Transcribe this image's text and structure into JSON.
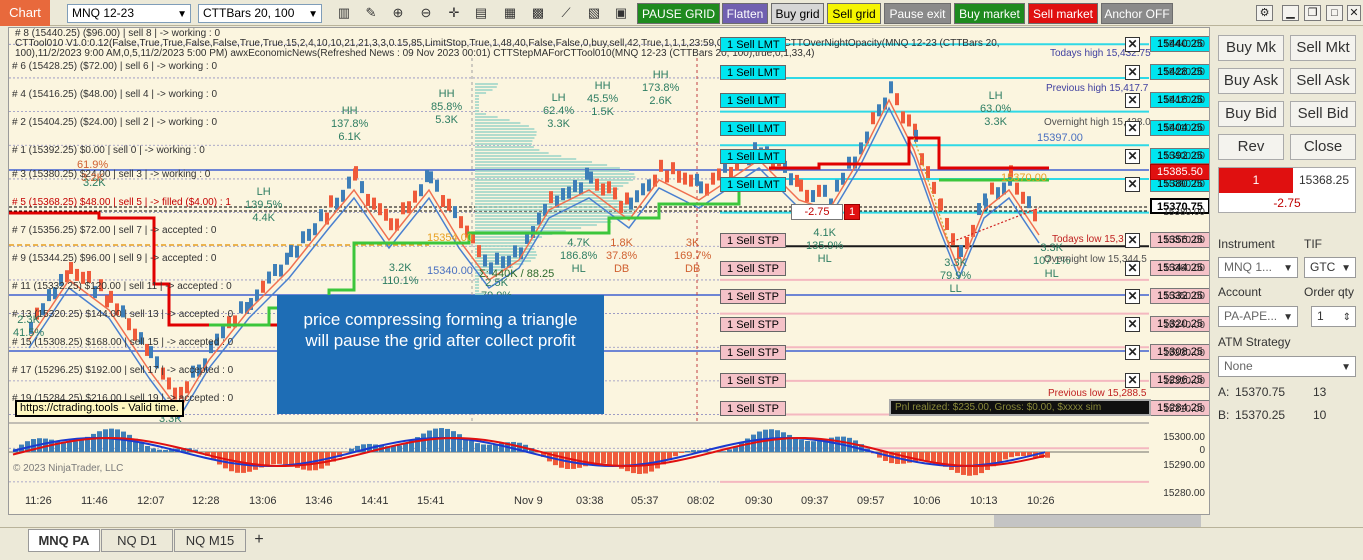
{
  "toolbar": {
    "chart_tab": "Chart",
    "instrument": "MNQ 12-23",
    "bars": "CTTBars 20, 100",
    "buttons": [
      {
        "label": "PAUSE GRID",
        "bg": "#1e8a1e",
        "fg": "#ffffff"
      },
      {
        "label": "Flatten",
        "bg": "#7060b0",
        "fg": "#ffffff"
      },
      {
        "label": "Buy grid",
        "bg": "#d6d6d6",
        "fg": "#000000"
      },
      {
        "label": "Sell grid",
        "bg": "#f5f500",
        "fg": "#000000"
      },
      {
        "label": "Pause exit",
        "bg": "#8a8a8a",
        "fg": "#ffffff"
      },
      {
        "label": "Buy market",
        "bg": "#1e8a1e",
        "fg": "#ffffff"
      },
      {
        "label": "Sell market",
        "bg": "#e01010",
        "fg": "#ffffff"
      },
      {
        "label": "Anchor OFF",
        "bg": "#8a8a8a",
        "fg": "#ffffff"
      }
    ],
    "icons": [
      "bar-type-icon",
      "pencil-icon",
      "zoom-in-icon",
      "zoom-out-icon",
      "crosshair-icon",
      "properties-icon",
      "strategies-icon",
      "indicators-icon",
      "templates-icon",
      "snapshot-icon",
      "data-box-icon"
    ]
  },
  "chart": {
    "header_lines": [
      "# 8 (15440.25) ($96.00) | sell 8 | -> working : 0",
      "CTTool010 V1.0:0.12(False,True,True,False,False,True,True,15,2,4,10,10,21,21,3,3,0.15,85,LimitStop,True,1,48,40,False,False,0,buy,sell,42,True,1,1,1,23:59,00:00,4,False) CTTOverNightOpacity(MNQ 12-23 (CTTBars 20,",
      "100),11/2/2023 9:00 AM,0,5,11/2/2023 5:00 PM) awxEconomicNews(Refreshed News : 09 Nov 2023 00:01) CTTStepMAForCTTool010(MNQ 12-23 (CTTBars 20, 100),true,0,1,33,4)"
    ],
    "grid_labels": [
      {
        "text": "# 6 (15428.25) ($72.00) | sell 6 | -> working : 0",
        "filled": false
      },
      {
        "text": "# 4 (15416.25) ($48.00) | sell 4 | -> working : 0",
        "filled": false
      },
      {
        "text": "# 2 (15404.25) ($24.00) | sell 2 | -> working : 0",
        "filled": false
      },
      {
        "text": "# 1 (15392.25) $0.00 | sell 0 | -> working : 0",
        "filled": false
      },
      {
        "text": "# 3 (15380.25) $24.00 | sell 3 | -> working : 0",
        "filled": false
      },
      {
        "text": "# 5 (15368.25) $48.00 | sell 5 | -> filled ($4.00) : 1",
        "filled": true
      },
      {
        "text": "# 7 (15356.25) $72.00 | sell 7 | -> accepted : 0",
        "filled": false
      },
      {
        "text": "# 9 (15344.25) $96.00 | sell 9 | -> accepted : 0",
        "filled": false
      },
      {
        "text": "# 11 (15332.25) $120.00 | sell 11 | -> accepted : 0",
        "filled": false
      },
      {
        "text": "# 13 (15320.25) $144.00 | sell 13 | -> accepted : 0",
        "filled": false
      },
      {
        "text": "# 15 (15308.25) $168.00 | sell 15 | -> accepted : 0",
        "filled": false
      },
      {
        "text": "# 17 (15296.25) $192.00 | sell 17 | -> accepted : 0",
        "filled": false
      },
      {
        "text": "# 19 (15284.25) $216.00 | sell 19 | -> accepted : 0",
        "filled": false
      }
    ],
    "swing_labels": [
      {
        "l1": "HH",
        "l2": "137.8%",
        "l3": "6.1K",
        "red": false
      },
      {
        "l1": "HH",
        "l2": "85.8%",
        "l3": "5.3K",
        "red": false
      },
      {
        "l1": "LH",
        "l2": "62.4%",
        "l3": "3.3K",
        "red": false
      },
      {
        "l1": "HH",
        "l2": "45.5%",
        "l3": "1.5K",
        "red": false
      },
      {
        "l1": "HH",
        "l2": "173.8%",
        "l3": "2.6K",
        "red": false
      },
      {
        "l1": "LH",
        "l2": "139.5%",
        "l3": "4.4K",
        "red": false
      },
      {
        "l1": "3.2K",
        "l2": "110.1%",
        "l3": "",
        "red": false
      },
      {
        "l1": "4.7K",
        "l2": "186.8%",
        "l3": "HL",
        "red": false
      },
      {
        "l1": "1.8K",
        "l2": "37.8%",
        "l3": "DB",
        "red": true
      },
      {
        "l1": "3K",
        "l2": "169.7%",
        "l3": "DB",
        "red": true
      },
      {
        "l1": "4.1K",
        "l2": "135.9%",
        "l3": "HL",
        "red": false
      },
      {
        "l1": "LH",
        "l2": "63.0%",
        "l3": "3.3K",
        "red": false
      },
      {
        "l1": "3.3K",
        "l2": "79.9%",
        "l3": "LL",
        "red": false
      },
      {
        "l1": "3.3K",
        "l2": "107.1%",
        "l3": "HL",
        "red": false
      },
      {
        "l1": "61.9%",
        "l2": "3.2K",
        "l3": "",
        "red": true
      },
      {
        "l1": "2.3K",
        "l2": "41.5%",
        "l3": "",
        "red": false
      },
      {
        "l1": "2.5K",
        "l2": "79.9%",
        "l3": "",
        "red": false
      },
      {
        "l1": "3.3K",
        "l2": "",
        "l3": "",
        "red": false
      },
      {
        "l1": "3.2K",
        "l2": "",
        "l3": "",
        "red": false
      }
    ],
    "sigma_label": "Σ: 440K / 88.25",
    "level_tags": [
      "15354.00",
      "15340.00",
      "15397.00",
      "15370.00"
    ],
    "annotations": {
      "todays_high": "Todays high 15,432.75",
      "previous_high": "Previous high 15,417.7",
      "overnight_high": "Overnight high 15,428.0",
      "todays_low": "Todays low 15,3",
      "overnight_low": "Overnight low 15,344.5",
      "previous_low": "Previous low 15,288.5"
    },
    "orders": [
      {
        "qty": "1",
        "label": "Sell LMT",
        "price": "15440.25",
        "kind": "lmt"
      },
      {
        "qty": "1",
        "label": "Sell LMT",
        "price": "15428.25",
        "kind": "lmt"
      },
      {
        "qty": "1",
        "label": "Sell LMT",
        "price": "15416.25",
        "kind": "lmt"
      },
      {
        "qty": "1",
        "label": "Sell LMT",
        "price": "15404.25",
        "kind": "lmt"
      },
      {
        "qty": "1",
        "label": "Sell LMT",
        "price": "15392.25",
        "kind": "lmt"
      },
      {
        "qty": "1",
        "label": "Sell LMT",
        "price": "15380.25",
        "kind": "lmt"
      },
      {
        "qty": "1",
        "label": "Sell STP",
        "price": "15356.25",
        "kind": "stp"
      },
      {
        "qty": "1",
        "label": "Sell STP",
        "price": "15344.25",
        "kind": "stp"
      },
      {
        "qty": "1",
        "label": "Sell STP",
        "price": "15332.25",
        "kind": "stp"
      },
      {
        "qty": "1",
        "label": "Sell STP",
        "price": "15320.25",
        "kind": "stp"
      },
      {
        "qty": "1",
        "label": "Sell STP",
        "price": "15308.25",
        "kind": "stp"
      },
      {
        "qty": "1",
        "label": "Sell STP",
        "price": "15296.25",
        "kind": "stp"
      },
      {
        "qty": "1",
        "label": "Sell STP",
        "price": "15284.25",
        "kind": "stp"
      }
    ],
    "position_marker": {
      "pnl": "-2.75",
      "qty": "1"
    },
    "current_price": "15385.50",
    "avg_price": "15370.75",
    "axis_prices": [
      "15440.00",
      "15430.00",
      "15420.00",
      "15410.00",
      "15400.00",
      "15390.00",
      "15380.00",
      "15370.00",
      "15360.00",
      "15350.00",
      "15340.00",
      "15330.00",
      "15320.00",
      "15310.00",
      "15300.00",
      "15290.00",
      "15280.00"
    ],
    "osc_axis": "0",
    "time_labels": [
      "11:26",
      "11:46",
      "12:07",
      "12:28",
      "13:06",
      "13:46",
      "14:41",
      "15:41",
      "Nov 9",
      "03:38",
      "05:37",
      "08:02",
      "09:30",
      "09:37",
      "09:57",
      "10:06",
      "10:13",
      "10:26"
    ],
    "license_text": "https://ctrading.tools - Valid time.",
    "copyright": "© 2023 NinjaTrader, LLC",
    "pnl_box": "Pnl realized: $235.00, Gross: $0.00, $xxxx sim"
  },
  "callout": {
    "line1": "price compressing forming a triangle",
    "line2": "will pause the grid after collect profit"
  },
  "panel": {
    "buy_mkt": "Buy Mk",
    "sell_mkt": "Sell Mkt",
    "buy_ask": "Buy Ask",
    "sell_ask": "Sell Ask",
    "buy_bid": "Buy Bid",
    "sell_bid": "Sell Bid",
    "rev": "Rev",
    "close": "Close",
    "position_qty": "1",
    "position_price": "15368.25",
    "position_pnl": "-2.75",
    "instrument_label": "Instrument",
    "tif_label": "TIF",
    "instrument_value": "MNQ 1...",
    "tif_value": "GTC",
    "account_label": "Account",
    "order_qty_label": "Order qty",
    "account_value": "PA-APE...",
    "order_qty_value": "1",
    "atm_label": "ATM Strategy",
    "atm_value": "None",
    "ask_label": "A:",
    "ask_price": "15370.75",
    "ask_size": "13",
    "bid_label": "B:",
    "bid_price": "15370.25",
    "bid_size": "10"
  },
  "tabs": [
    "MNQ PA",
    "NQ D1",
    "NQ M15",
    "+"
  ],
  "colors": {
    "accent_orange": "#e8693c",
    "sell_lmt": "#00e5f0",
    "sell_stp": "#f5c2c8",
    "stepma_red": "#e00000",
    "stepma_green": "#3cc63c",
    "bar_blue": "#3e7fb8",
    "bar_red": "#ef5a3a",
    "callout_blue": "#1e6db5"
  }
}
